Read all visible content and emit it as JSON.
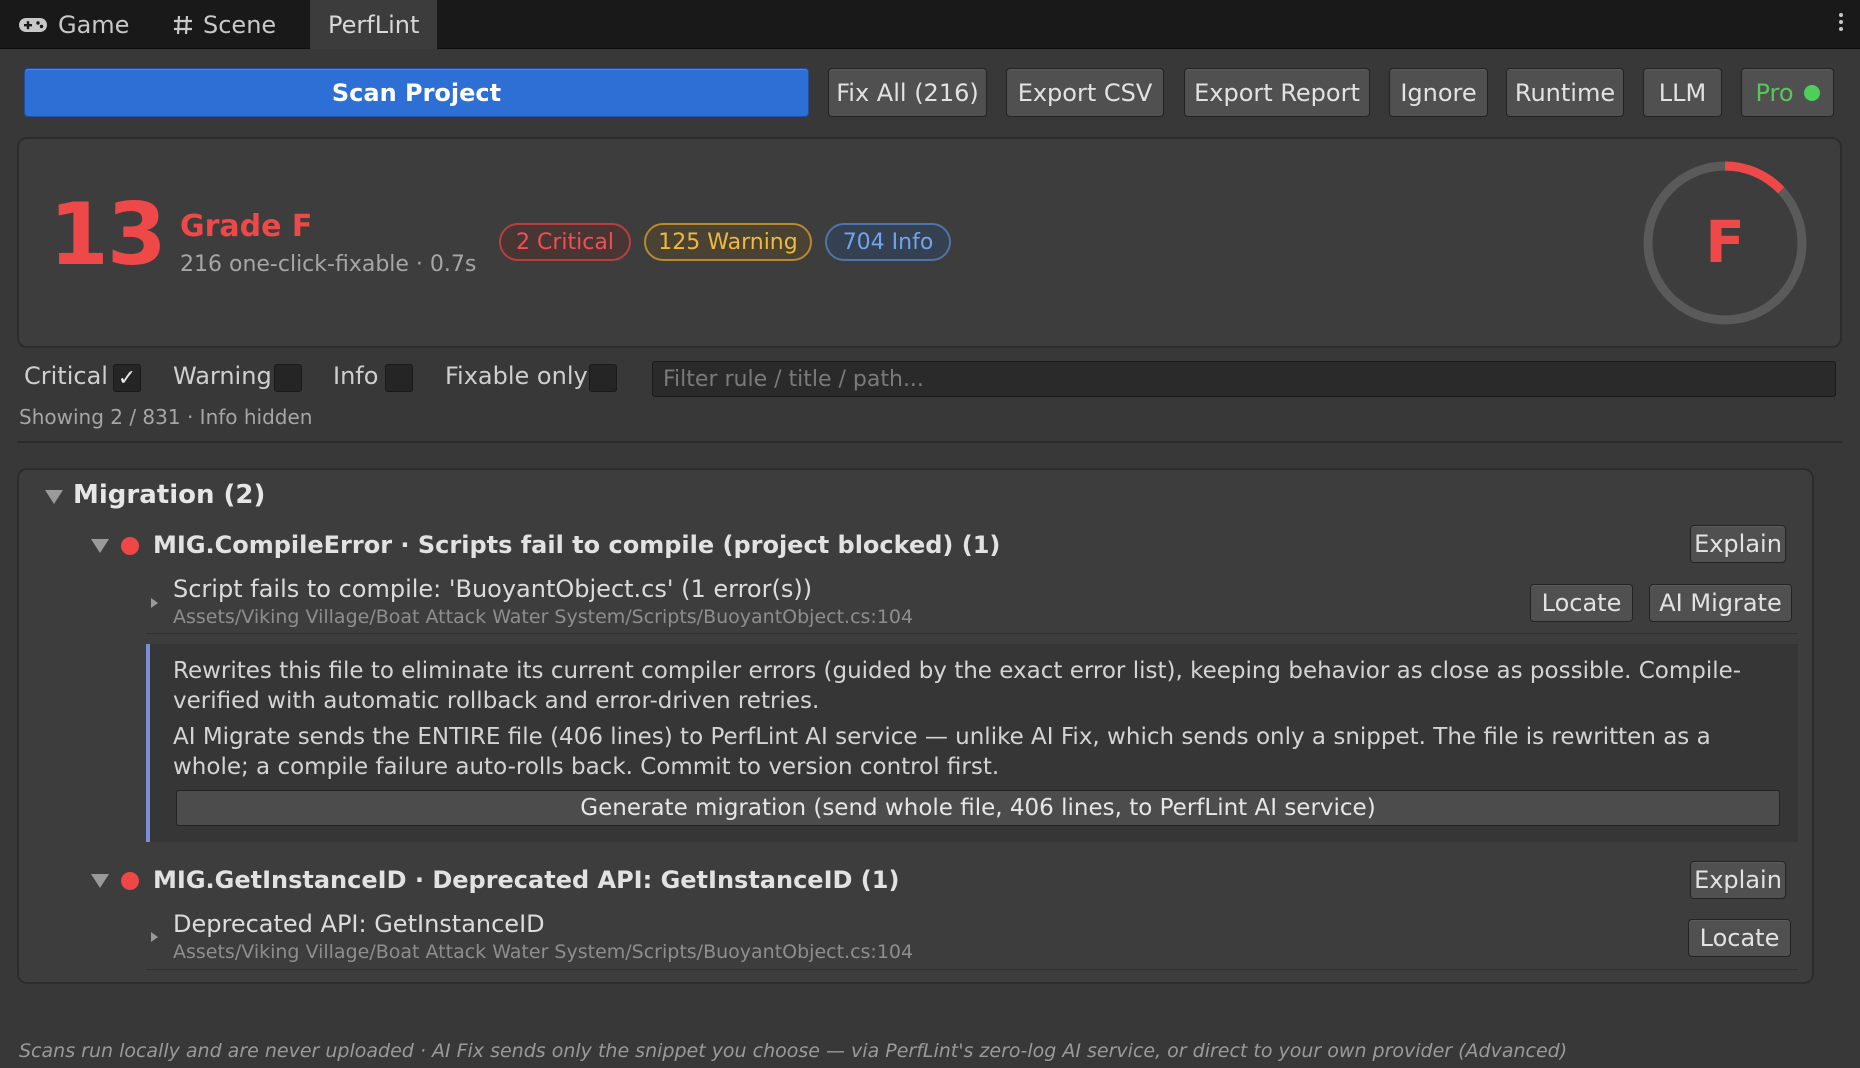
{
  "tabs": [
    {
      "label": "Game",
      "icon": "gamepad-icon"
    },
    {
      "label": "Scene",
      "icon": "grid-icon"
    },
    {
      "label": "PerfLint",
      "active": true
    }
  ],
  "toolbar": {
    "scan_label": "Scan Project",
    "fix_all_label": "Fix All (216)",
    "export_csv_label": "Export CSV",
    "export_report_label": "Export Report",
    "ignore_label": "Ignore",
    "runtime_label": "Runtime",
    "llm_label": "LLM",
    "pro_label": "Pro",
    "pro_status_color": "#4ecf5a"
  },
  "summary": {
    "score": "13",
    "grade_label": "Grade F",
    "subinfo": "216 one-click-fixable · 0.7s",
    "badges": {
      "critical": "2 Critical",
      "warning": "125 Warning",
      "info": "704 Info"
    },
    "ring_letter": "F",
    "ring_progress": 0.13,
    "colors": {
      "critical": "#ef4848",
      "warning": "#f0b93a",
      "info": "#6fa4f2"
    }
  },
  "filters": {
    "critical_label": "Critical",
    "critical_checked": true,
    "warning_label": "Warning",
    "warning_checked": false,
    "info_label": "Info",
    "info_checked": false,
    "fixable_label": "Fixable only",
    "fixable_checked": false,
    "search_placeholder": "Filter rule / title / path...",
    "showing": "Showing 2 / 831 · Info hidden"
  },
  "results": {
    "group_title": "Migration (2)",
    "rules": [
      {
        "title": "MIG.CompileError · Scripts fail to compile (project blocked) (1)",
        "explain_label": "Explain",
        "item_title": "Script fails to compile: 'BuoyantObject.cs' (1 error(s))",
        "item_path": "Assets/Viking Village/Boat Attack Water System/Scripts/BuoyantObject.cs:104",
        "locate_label": "Locate",
        "migrate_label": "AI Migrate",
        "detail_p1": "Rewrites this file to eliminate its current compiler errors (guided by the exact error list), keeping behavior as close as possible. Compile-verified with automatic rollback and error-driven retries.",
        "detail_p2": "AI Migrate sends the ENTIRE file (406 lines) to PerfLint AI service — unlike AI Fix, which sends only a snippet. The file is rewritten as a whole; a compile failure auto-rolls back. Commit to version control first.",
        "generate_label": "Generate migration (send whole file, 406 lines, to PerfLint AI service)"
      },
      {
        "title": "MIG.GetInstanceID · Deprecated API: GetInstanceID (1)",
        "explain_label": "Explain",
        "item_title": "Deprecated API: GetInstanceID",
        "item_path": "Assets/Viking Village/Boat Attack Water System/Scripts/BuoyantObject.cs:104",
        "locate_label": "Locate"
      }
    ]
  },
  "footer": "Scans run locally and are never uploaded · AI Fix sends only the snippet you choose — via PerfLint's zero-log AI service, or direct to your own provider (Advanced)"
}
